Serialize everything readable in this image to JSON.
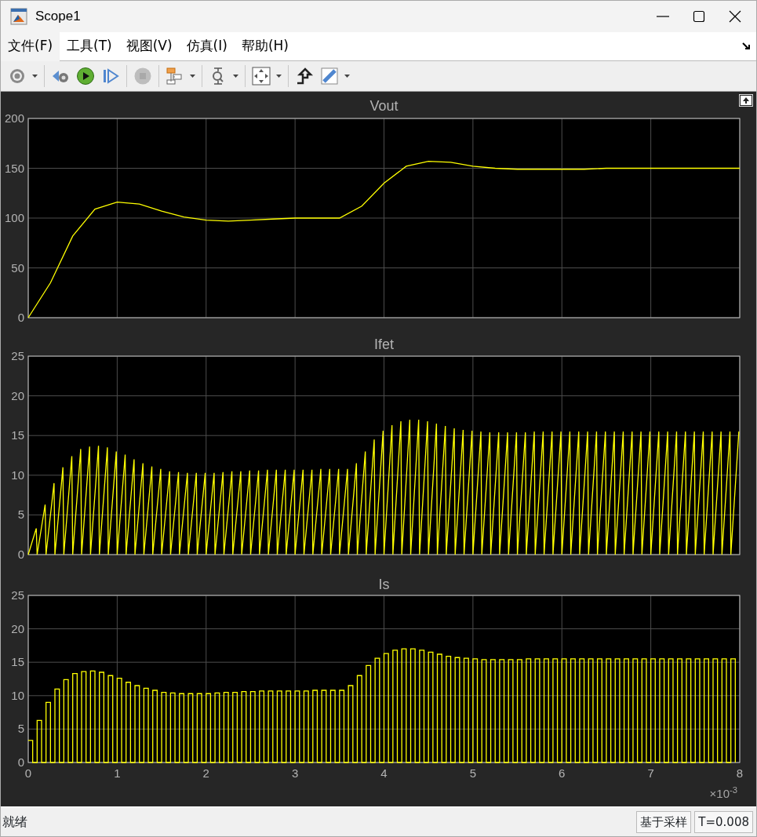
{
  "window": {
    "title": "Scope1"
  },
  "menu": [
    {
      "label": "文件(F)",
      "selected": true
    },
    {
      "label": "工具(T)",
      "selected": false
    },
    {
      "label": "视图(V)",
      "selected": false
    },
    {
      "label": "仿真(I)",
      "selected": false
    },
    {
      "label": "帮助(H)",
      "selected": false
    }
  ],
  "toolbar": [
    {
      "kind": "settings",
      "dropdown": true,
      "disabled": false
    },
    {
      "kind": "stepback",
      "dropdown": false,
      "disabled": false
    },
    {
      "kind": "run",
      "dropdown": false,
      "disabled": false
    },
    {
      "kind": "step",
      "dropdown": false,
      "disabled": false
    },
    {
      "kind": "stop",
      "dropdown": false,
      "disabled": true
    },
    {
      "kind": "blocks",
      "dropdown": true,
      "disabled": false
    },
    {
      "kind": "zoom",
      "dropdown": true,
      "disabled": false
    },
    {
      "kind": "fit",
      "dropdown": true,
      "disabled": false
    },
    {
      "kind": "triggers",
      "dropdown": false,
      "disabled": false
    },
    {
      "kind": "measure",
      "dropdown": true,
      "disabled": false
    }
  ],
  "plots": [
    {
      "chart_data": {
        "type": "line",
        "title": "Vout",
        "grid": true,
        "xlim": [
          0,
          8
        ],
        "ylim": [
          0,
          200
        ],
        "yticks": [
          0,
          50,
          100,
          150,
          200
        ],
        "x": [
          0,
          0.25,
          0.5,
          0.75,
          1,
          1.25,
          1.5,
          1.75,
          2,
          2.25,
          2.5,
          2.75,
          3,
          3.25,
          3.5,
          3.75,
          4,
          4.25,
          4.5,
          4.75,
          5,
          5.25,
          5.5,
          5.75,
          6,
          6.25,
          6.5,
          6.75,
          7,
          7.25,
          7.5,
          7.75,
          8
        ],
        "series": [
          {
            "color": "#ffff00",
            "values": [
              0,
              35,
              82,
              109,
              116,
              114,
              107,
              101,
              98,
              97,
              98,
              99,
              100,
              100,
              100,
              112,
              135,
              152,
              157,
              156,
              152,
              150,
              149,
              149,
              149,
              149,
              150,
              150,
              150,
              150,
              150,
              150,
              150
            ]
          }
        ]
      }
    },
    {
      "chart_data": {
        "type": "line",
        "title": "Ifet",
        "grid": true,
        "xlim": [
          0,
          8
        ],
        "ylim": [
          0,
          25
        ],
        "yticks": [
          0,
          5,
          10,
          15,
          20,
          25
        ],
        "x": [
          0,
          0.09,
          0.1,
          0.19,
          0.2,
          0.29,
          0.3,
          0.39,
          0.4,
          0.49,
          0.5,
          0.59,
          0.6,
          0.69,
          0.7,
          0.79,
          0.8,
          0.89,
          0.9,
          0.99,
          1,
          1.09,
          1.1,
          1.19,
          1.2,
          1.29,
          1.3,
          1.39,
          1.4,
          1.49,
          1.5,
          1.59,
          1.6,
          1.69,
          1.7,
          1.79,
          1.8,
          1.89,
          1.9,
          1.99,
          2,
          2.09,
          2.1,
          2.19,
          2.2,
          2.29,
          2.3,
          2.39,
          2.4,
          2.49,
          2.5,
          2.59,
          2.6,
          2.69,
          2.7,
          2.79,
          2.8,
          2.89,
          2.9,
          2.99,
          3,
          3.09,
          3.1,
          3.19,
          3.2,
          3.29,
          3.3,
          3.39,
          3.4,
          3.49,
          3.5,
          3.59,
          3.6,
          3.69,
          3.7,
          3.79,
          3.8,
          3.89,
          3.9,
          3.99,
          4,
          4.09,
          4.1,
          4.19,
          4.2,
          4.29,
          4.3,
          4.39,
          4.4,
          4.49,
          4.5,
          4.59,
          4.6,
          4.69,
          4.7,
          4.79,
          4.8,
          4.89,
          4.9,
          4.99,
          5,
          5.09,
          5.1,
          5.19,
          5.2,
          5.29,
          5.3,
          5.39,
          5.4,
          5.49,
          5.5,
          5.59,
          5.6,
          5.69,
          5.7,
          5.79,
          5.8,
          5.89,
          5.9,
          5.99,
          6,
          6.09,
          6.1,
          6.19,
          6.2,
          6.29,
          6.3,
          6.39,
          6.4,
          6.49,
          6.5,
          6.59,
          6.6,
          6.69,
          6.7,
          6.79,
          6.8,
          6.89,
          6.9,
          6.99,
          7,
          7.09,
          7.1,
          7.19,
          7.2,
          7.29,
          7.3,
          7.39,
          7.4,
          7.49,
          7.5,
          7.59,
          7.6,
          7.69,
          7.7,
          7.79,
          7.8,
          7.89,
          7.9,
          7.99
        ],
        "series": [
          {
            "color": "#ffff00",
            "values": [
              0,
              3.3,
              0,
              6.3,
              0,
              9.0,
              0,
              11.0,
              0,
              12.4,
              0,
              13.3,
              0,
              13.6,
              0,
              13.7,
              0,
              13.5,
              0,
              13.0,
              0,
              12.6,
              0,
              12.0,
              0,
              11.5,
              0,
              11.1,
              0,
              10.8,
              0,
              10.5,
              0,
              10.4,
              0,
              10.3,
              0,
              10.3,
              0,
              10.3,
              0,
              10.3,
              0,
              10.4,
              0,
              10.5,
              0,
              10.5,
              0,
              10.6,
              0,
              10.6,
              0,
              10.7,
              0,
              10.7,
              0,
              10.7,
              0,
              10.7,
              0,
              10.7,
              0,
              10.7,
              0,
              10.8,
              0,
              10.8,
              0,
              10.8,
              0,
              10.8,
              0,
              11.5,
              0,
              13.0,
              0,
              14.5,
              0,
              15.6,
              0,
              16.3,
              0,
              16.8,
              0,
              17.0,
              0,
              17.0,
              0,
              16.8,
              0,
              16.5,
              0,
              16.2,
              0,
              15.9,
              0,
              15.7,
              0,
              15.6,
              0,
              15.5,
              0,
              15.4,
              0,
              15.4,
              0,
              15.4,
              0,
              15.4,
              0,
              15.4,
              0,
              15.5,
              0,
              15.5,
              0,
              15.5,
              0,
              15.5,
              0,
              15.5,
              0,
              15.5,
              0,
              15.5,
              0,
              15.5,
              0,
              15.5,
              0,
              15.5,
              0,
              15.5,
              0,
              15.5,
              0,
              15.5,
              0,
              15.5,
              0,
              15.5,
              0,
              15.5,
              0,
              15.5,
              0,
              15.5,
              0,
              15.5,
              0,
              15.5,
              0,
              15.5,
              0,
              15.5,
              0,
              15.5,
              0,
              15.5
            ]
          }
        ]
      }
    },
    {
      "chart_data": {
        "type": "line",
        "title": "Is",
        "grid": true,
        "xlim": [
          0,
          8
        ],
        "ylim": [
          0,
          25
        ],
        "yticks": [
          0,
          5,
          10,
          15,
          20,
          25
        ],
        "xticks": [
          0,
          1,
          2,
          3,
          4,
          5,
          6,
          7,
          8
        ],
        "x": [
          0,
          0.05,
          0.05,
          0.1,
          0.1,
          0.15,
          0.15,
          0.2,
          0.2,
          0.25,
          0.25,
          0.3,
          0.3,
          0.35,
          0.35,
          0.4,
          0.4,
          0.45,
          0.45,
          0.5,
          0.5,
          0.55,
          0.55,
          0.6,
          0.6,
          0.65,
          0.65,
          0.7,
          0.7,
          0.75,
          0.75,
          0.8,
          0.8,
          0.85,
          0.85,
          0.9,
          0.9,
          0.95,
          0.95,
          1,
          1,
          1.05,
          1.05,
          1.1,
          1.1,
          1.15,
          1.15,
          1.2,
          1.2,
          1.25,
          1.25,
          1.3,
          1.3,
          1.35,
          1.35,
          1.4,
          1.4,
          1.45,
          1.45,
          1.5,
          1.5,
          1.55,
          1.55,
          1.6,
          1.6,
          1.65,
          1.65,
          1.7,
          1.7,
          1.75,
          1.75,
          1.8,
          1.8,
          1.85,
          1.85,
          1.9,
          1.9,
          1.95,
          1.95,
          2,
          2,
          2.05,
          2.05,
          2.1,
          2.1,
          2.15,
          2.15,
          2.2,
          2.2,
          2.25,
          2.25,
          2.3,
          2.3,
          2.35,
          2.35,
          2.4,
          2.4,
          2.45,
          2.45,
          2.5,
          2.5,
          2.55,
          2.55,
          2.6,
          2.6,
          2.65,
          2.65,
          2.7,
          2.7,
          2.75,
          2.75,
          2.8,
          2.8,
          2.85,
          2.85,
          2.9,
          2.9,
          2.95,
          2.95,
          3,
          3,
          3.05,
          3.05,
          3.1,
          3.1,
          3.15,
          3.15,
          3.2,
          3.2,
          3.25,
          3.25,
          3.3,
          3.3,
          3.35,
          3.35,
          3.4,
          3.4,
          3.45,
          3.45,
          3.5,
          3.5,
          3.55,
          3.55,
          3.6,
          3.6,
          3.65,
          3.65,
          3.7,
          3.7,
          3.75,
          3.75,
          3.8,
          3.8,
          3.85,
          3.85,
          3.9,
          3.9,
          3.95,
          3.95,
          4,
          4,
          4.05,
          4.05,
          4.1,
          4.1,
          4.15,
          4.15,
          4.2,
          4.2,
          4.25,
          4.25,
          4.3,
          4.3,
          4.35,
          4.35,
          4.4,
          4.4,
          4.45,
          4.45,
          4.5,
          4.5,
          4.55,
          4.55,
          4.6,
          4.6,
          4.65,
          4.65,
          4.7,
          4.7,
          4.75,
          4.75,
          4.8,
          4.8,
          4.85,
          4.85,
          4.9,
          4.9,
          4.95,
          4.95,
          5,
          5,
          5.05,
          5.05,
          5.1,
          5.1,
          5.15,
          5.15,
          5.2,
          5.2,
          5.25,
          5.25,
          5.3,
          5.3,
          5.35,
          5.35,
          5.4,
          5.4,
          5.45,
          5.45,
          5.5,
          5.5,
          5.55,
          5.55,
          5.6,
          5.6,
          5.65,
          5.65,
          5.7,
          5.7,
          5.75,
          5.75,
          5.8,
          5.8,
          5.85,
          5.85,
          5.9,
          5.9,
          5.95,
          5.95,
          6,
          6,
          6.05,
          6.05,
          6.1,
          6.1,
          6.15,
          6.15,
          6.2,
          6.2,
          6.25,
          6.25,
          6.3,
          6.3,
          6.35,
          6.35,
          6.4,
          6.4,
          6.45,
          6.45,
          6.5,
          6.5,
          6.55,
          6.55,
          6.6,
          6.6,
          6.65,
          6.65,
          6.7,
          6.7,
          6.75,
          6.75,
          6.8,
          6.8,
          6.85,
          6.85,
          6.9,
          6.9,
          6.95,
          6.95,
          7,
          7,
          7.05,
          7.05,
          7.1,
          7.1,
          7.15,
          7.15,
          7.2,
          7.2,
          7.25,
          7.25,
          7.3,
          7.3,
          7.35,
          7.35,
          7.4,
          7.4,
          7.45,
          7.45,
          7.5,
          7.5,
          7.55,
          7.55,
          7.6,
          7.6,
          7.65,
          7.65,
          7.7,
          7.7,
          7.75,
          7.75,
          7.8,
          7.8,
          7.85,
          7.85,
          7.9,
          7.9,
          7.95,
          7.95
        ],
        "series": [
          {
            "color": "#ffff00",
            "values": [
              3.3,
              3.3,
              0,
              0,
              6.3,
              6.3,
              0,
              0,
              9.0,
              9.0,
              0,
              0,
              11.0,
              11.0,
              0,
              0,
              12.4,
              12.4,
              0,
              0,
              13.3,
              13.3,
              0,
              0,
              13.6,
              13.6,
              0,
              0,
              13.7,
              13.7,
              0,
              0,
              13.5,
              13.5,
              0,
              0,
              13.0,
              13.0,
              0,
              0,
              12.6,
              12.6,
              0,
              0,
              12.0,
              12.0,
              0,
              0,
              11.5,
              11.5,
              0,
              0,
              11.1,
              11.1,
              0,
              0,
              10.8,
              10.8,
              0,
              0,
              10.5,
              10.5,
              0,
              0,
              10.4,
              10.4,
              0,
              0,
              10.3,
              10.3,
              0,
              0,
              10.3,
              10.3,
              0,
              0,
              10.3,
              10.3,
              0,
              0,
              10.3,
              10.3,
              0,
              0,
              10.4,
              10.4,
              0,
              0,
              10.5,
              10.5,
              0,
              0,
              10.5,
              10.5,
              0,
              0,
              10.6,
              10.6,
              0,
              0,
              10.6,
              10.6,
              0,
              0,
              10.7,
              10.7,
              0,
              0,
              10.7,
              10.7,
              0,
              0,
              10.7,
              10.7,
              0,
              0,
              10.7,
              10.7,
              0,
              0,
              10.7,
              10.7,
              0,
              0,
              10.7,
              10.7,
              0,
              0,
              10.8,
              10.8,
              0,
              0,
              10.8,
              10.8,
              0,
              0,
              10.8,
              10.8,
              0,
              0,
              10.8,
              10.8,
              0,
              0,
              11.5,
              11.5,
              0,
              0,
              13.0,
              13.0,
              0,
              0,
              14.5,
              14.5,
              0,
              0,
              15.6,
              15.6,
              0,
              0,
              16.3,
              16.3,
              0,
              0,
              16.8,
              16.8,
              0,
              0,
              17.0,
              17.0,
              0,
              0,
              17.0,
              17.0,
              0,
              0,
              16.8,
              16.8,
              0,
              0,
              16.5,
              16.5,
              0,
              0,
              16.2,
              16.2,
              0,
              0,
              15.9,
              15.9,
              0,
              0,
              15.7,
              15.7,
              0,
              0,
              15.6,
              15.6,
              0,
              0,
              15.5,
              15.5,
              0,
              0,
              15.4,
              15.4,
              0,
              0,
              15.4,
              15.4,
              0,
              0,
              15.4,
              15.4,
              0,
              0,
              15.4,
              15.4,
              0,
              0,
              15.4,
              15.4,
              0,
              0,
              15.5,
              15.5,
              0,
              0,
              15.5,
              15.5,
              0,
              0,
              15.5,
              15.5,
              0,
              0,
              15.5,
              15.5,
              0,
              0,
              15.5,
              15.5,
              0,
              0,
              15.5,
              15.5,
              0,
              0,
              15.5,
              15.5,
              0,
              0,
              15.5,
              15.5,
              0,
              0,
              15.5,
              15.5,
              0,
              0,
              15.5,
              15.5,
              0,
              0,
              15.5,
              15.5,
              0,
              0,
              15.5,
              15.5,
              0,
              0,
              15.5,
              15.5,
              0,
              0,
              15.5,
              15.5,
              0,
              0,
              15.5,
              15.5,
              0,
              0,
              15.5,
              15.5,
              0,
              0,
              15.5,
              15.5,
              0,
              0,
              15.5,
              15.5,
              0,
              0,
              15.5,
              15.5,
              0,
              0,
              15.5,
              15.5,
              0,
              0,
              15.5,
              15.5,
              0,
              0,
              15.5,
              15.5,
              0,
              0,
              15.5,
              15.5,
              0,
              0,
              15.5,
              15.5,
              0
            ]
          }
        ]
      }
    }
  ],
  "x_exponent": "×10$^{-3}$",
  "status_bar": {
    "message": "就绪",
    "sections": [
      "基于采样",
      "T=0.008"
    ]
  }
}
